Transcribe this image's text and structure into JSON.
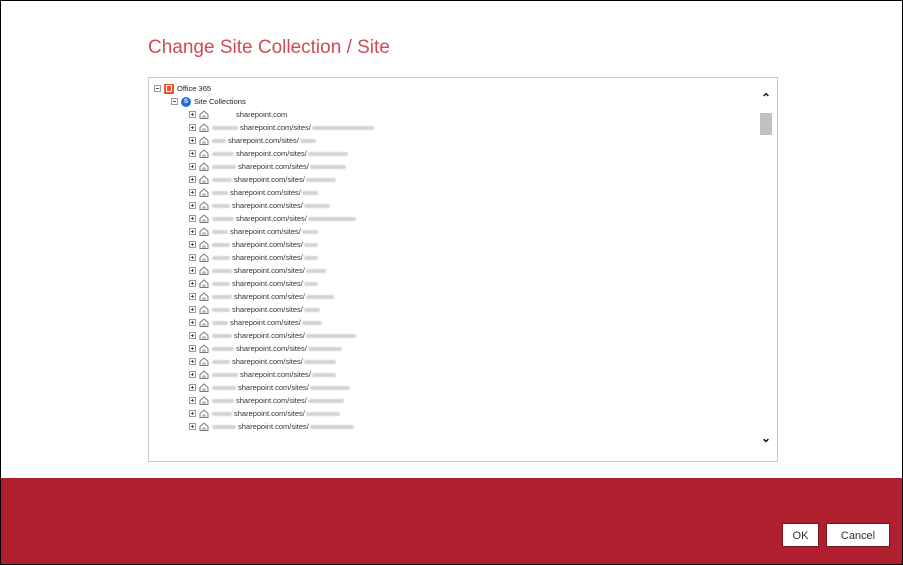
{
  "dialog": {
    "title": "Change Site Collection / Site",
    "ok_label": "OK",
    "cancel_label": "Cancel"
  },
  "tree": {
    "root": {
      "label": "Office 365",
      "icon": "office365-icon",
      "expanded": true
    },
    "collections": {
      "label": "Site Collections",
      "icon": "sharepoint-icon",
      "expanded": true
    },
    "sites": [
      "sharepoint.com",
      "sharepoint.com/sites/",
      "sharepoint.com/sites/",
      "sharepoint.com/sites/",
      "sharepoint.com/sites/",
      "sharepoint.com/sites/",
      "sharepoint.com/sites/",
      "sharepoint.com/sites/",
      "sharepoint.com/sites/",
      "sharepoint.com/sites/",
      "sharepoint.com/sites/",
      "sharepoint.com/sites/",
      "sharepoint.com/sites/",
      "sharepoint.com/sites/",
      "sharepoint.com/sites/",
      "sharepoint.com/sites/",
      "sharepoint.com/sites/",
      "sharepoint.com/sites/",
      "sharepoint.com/sites/",
      "sharepoint.com/sites/",
      "sharepoint.com/sites/",
      "sharepoint.com/sites/",
      "sharepoint.com/sites/",
      "sharepoint.com/sites/",
      "sharepoint.com/sites/"
    ]
  },
  "colors": {
    "title": "#d24a58",
    "footer": "#b01f2e"
  },
  "icons": {
    "scroll_up": "chevron-up-icon",
    "scroll_down": "chevron-down-icon",
    "site": "site-home-icon"
  }
}
